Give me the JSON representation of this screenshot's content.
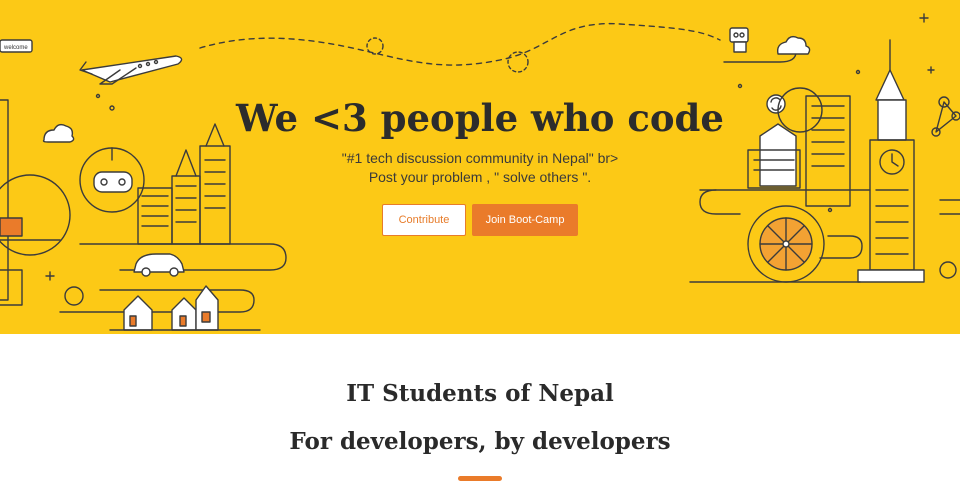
{
  "hero": {
    "title": "We <3 people who code",
    "subtitle_line1": "\"#1 tech discussion community in Nepal\" br>",
    "subtitle_line2": "Post your problem , \" solve others \".",
    "contribute_label": "Contribute",
    "join_label": "Join Boot-Camp",
    "welcome_sign": "welcome",
    "background_color": "#fcc916"
  },
  "section": {
    "title": "IT Students of Nepal",
    "subtitle": "For developers, by developers",
    "accent_color": "#ea7b2a"
  },
  "icons": [
    "airplane-icon",
    "cloud-icon",
    "game-controller-icon",
    "car-icon",
    "robot-icon",
    "clock-tower-icon",
    "ferris-wheel-icon",
    "sync-icon",
    "bicycle-icon"
  ]
}
